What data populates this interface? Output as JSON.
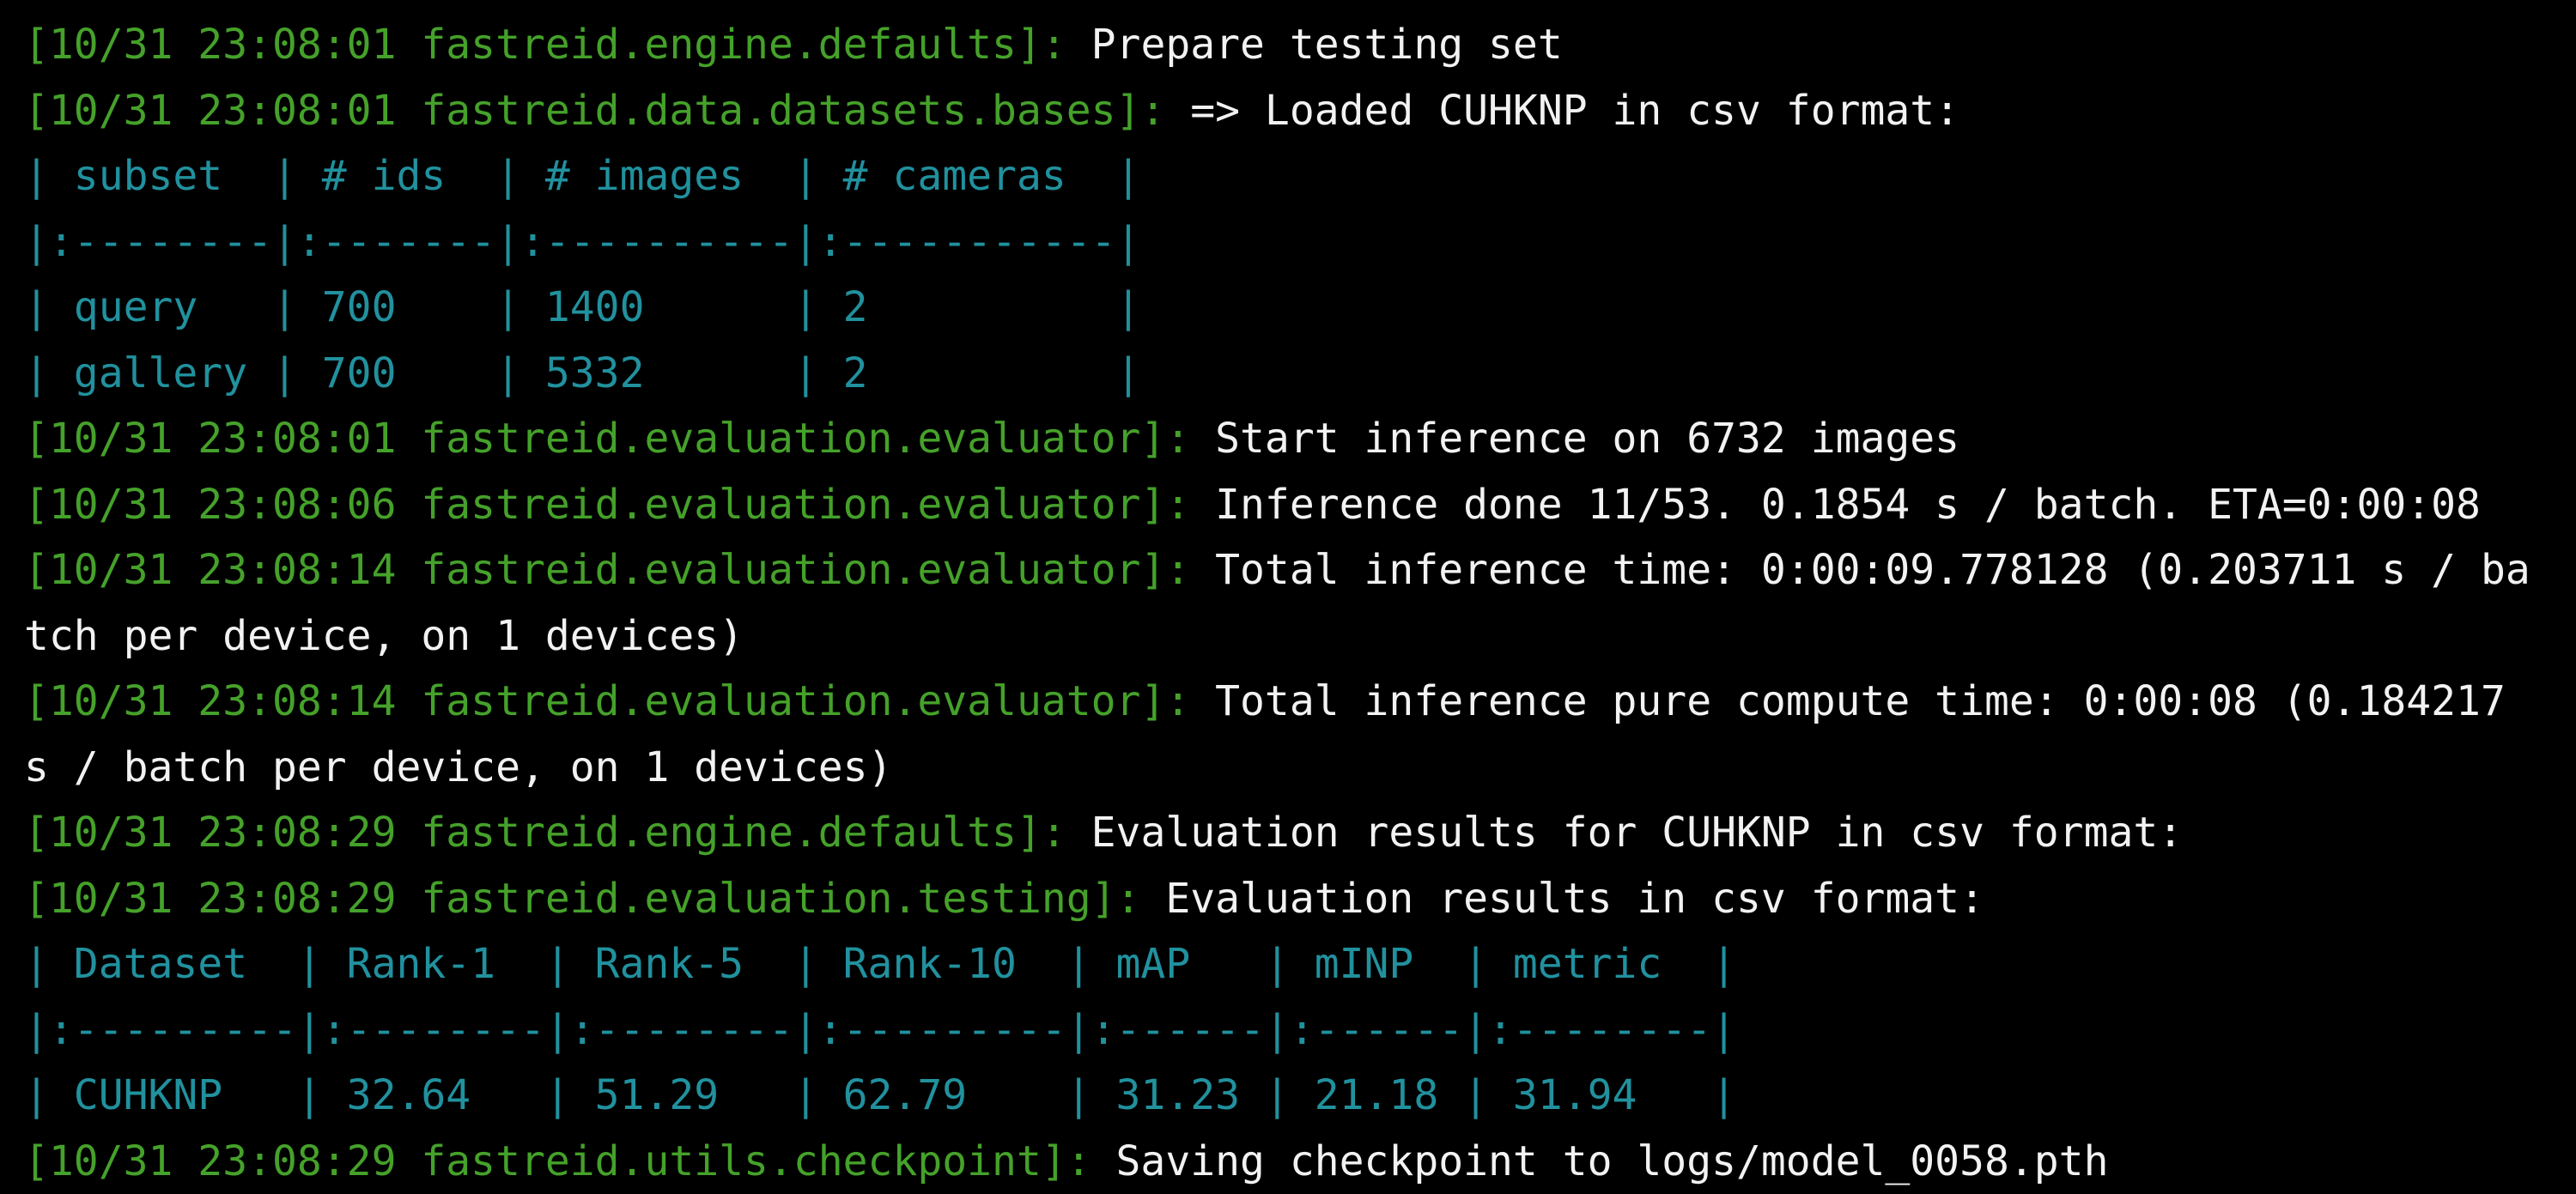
{
  "window": {
    "title": ""
  },
  "colors": {
    "background": "#000000",
    "prefix": "#45a12a",
    "message": "#f2f2f2",
    "table": "#21919e"
  },
  "lines": [
    {
      "prefix": "[10/31 23:08:01 fastreid.engine.defaults]: ",
      "msg": "Prepare testing set"
    },
    {
      "prefix": "[10/31 23:08:01 fastreid.data.datasets.bases]: ",
      "msg": "=> Loaded CUHKNP in csv format:"
    },
    {
      "table": "| subset  | # ids  | # images  | # cameras  |"
    },
    {
      "table": "|:--------|:-------|:----------|:-----------|"
    },
    {
      "table": "| query   | 700    | 1400      | 2          |"
    },
    {
      "table": "| gallery | 700    | 5332      | 2          |"
    },
    {
      "prefix": "[10/31 23:08:01 fastreid.evaluation.evaluator]: ",
      "msg": "Start inference on 6732 images"
    },
    {
      "prefix": "[10/31 23:08:06 fastreid.evaluation.evaluator]: ",
      "msg": "Inference done 11/53. 0.1854 s / batch. ETA=0:00:08"
    },
    {
      "prefix": "[10/31 23:08:14 fastreid.evaluation.evaluator]: ",
      "msg": "Total inference time: 0:00:09.778128 (0.203711 s / ba"
    },
    {
      "msg": "tch per device, on 1 devices)"
    },
    {
      "prefix": "[10/31 23:08:14 fastreid.evaluation.evaluator]: ",
      "msg": "Total inference pure compute time: 0:00:08 (0.184217"
    },
    {
      "msg": "s / batch per device, on 1 devices)"
    },
    {
      "prefix": "[10/31 23:08:29 fastreid.engine.defaults]: ",
      "msg": "Evaluation results for CUHKNP in csv format:"
    },
    {
      "prefix": "[10/31 23:08:29 fastreid.evaluation.testing]: ",
      "msg": "Evaluation results in csv format:"
    },
    {
      "table": "| Dataset  | Rank-1  | Rank-5  | Rank-10  | mAP   | mINP  | metric  |"
    },
    {
      "table": "|:---------|:--------|:--------|:---------|:------|:------|:--------|"
    },
    {
      "table": "| CUHKNP   | 32.64   | 51.29   | 62.79    | 31.23 | 21.18 | 31.94   |"
    },
    {
      "prefix": "[10/31 23:08:29 fastreid.utils.checkpoint]: ",
      "msg": "Saving checkpoint to logs/model_0058.pth"
    }
  ]
}
